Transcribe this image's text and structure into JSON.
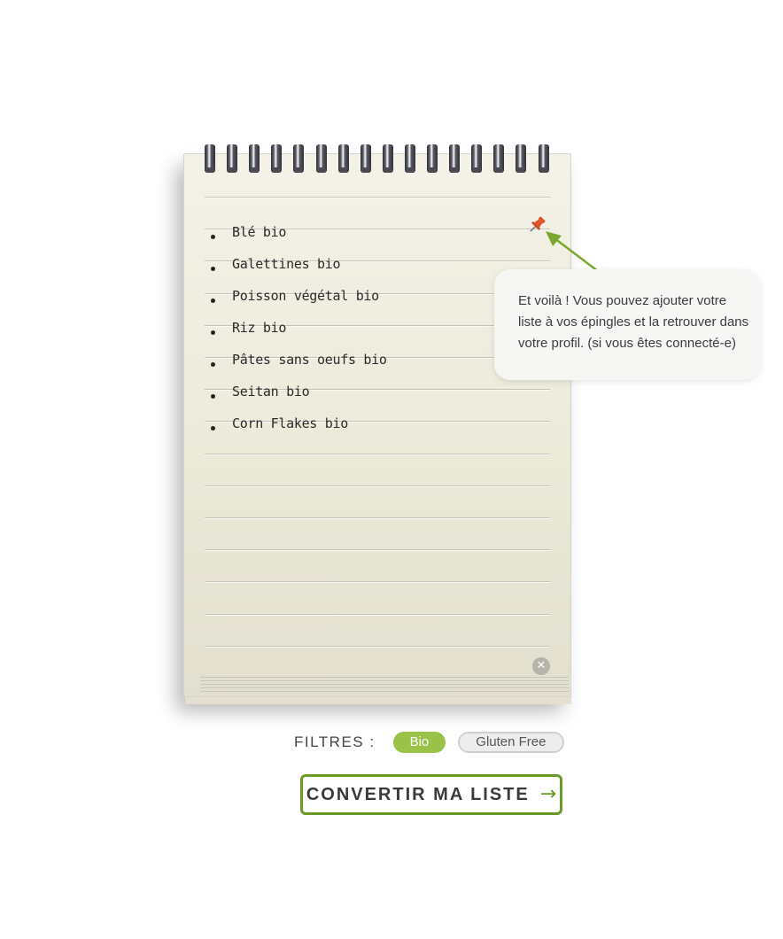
{
  "list": {
    "items": [
      "Blé bio",
      "Galettines bio",
      "Poisson végétal bio",
      "Riz bio",
      "Pâtes sans oeufs bio",
      "Seitan bio",
      "Corn Flakes bio"
    ],
    "pin_icon": "pushpin-icon",
    "clear_icon": "close-icon"
  },
  "tooltip": {
    "text": "Et voilà ! Vous pouvez ajouter votre liste à vos épingles et la retrouver dans votre profil. (si vous êtes connecté-e)"
  },
  "filters": {
    "label": "FILTRES :",
    "options": [
      {
        "label": "Bio",
        "active": true
      },
      {
        "label": "Gluten Free",
        "active": false
      }
    ]
  },
  "convert_button": {
    "label": "CONVERTIR MA LISTE",
    "arrow": "→"
  },
  "colors": {
    "accent_green": "#6a9a28",
    "chip_green": "#9bc248",
    "pin_red": "#e0522a"
  }
}
